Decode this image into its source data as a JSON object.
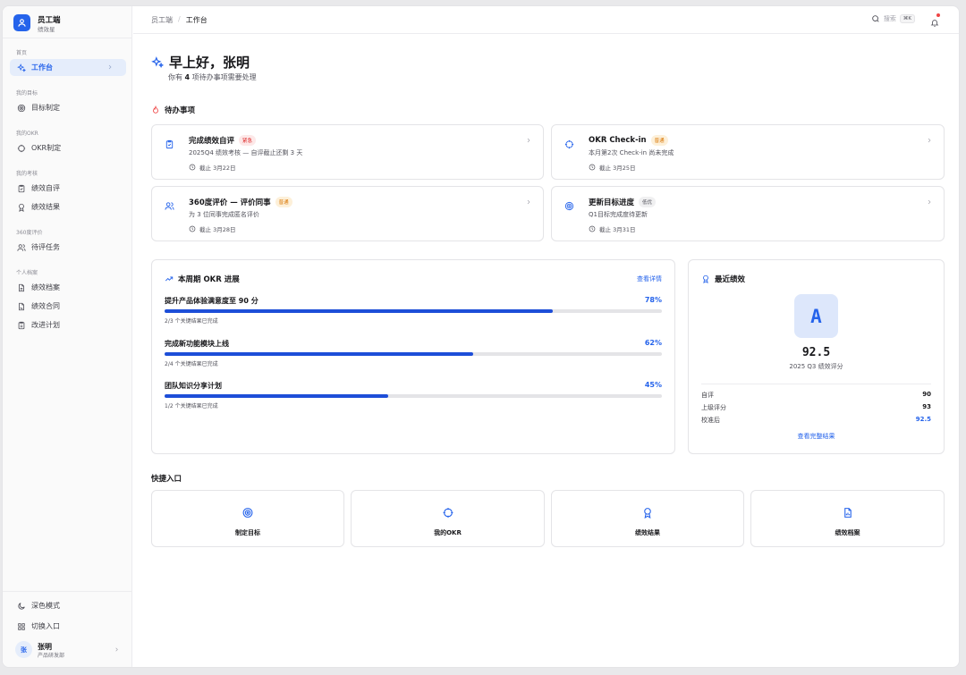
{
  "brand": {
    "title": "员工端",
    "subtitle": "绩效星"
  },
  "sidebar": {
    "sections": {
      "home": "首页",
      "goals": "我的目标",
      "okr": "我的OKR",
      "review": "我的考核",
      "eval360": "360度评价",
      "profile": "个人档案"
    },
    "items": {
      "workbench": "工作台",
      "goal_setting": "目标制定",
      "okr_setting": "OKR制定",
      "self_review": "绩效自评",
      "results": "绩效结果",
      "pending_tasks": "待评任务",
      "archive": "绩效档案",
      "contract": "绩效合同",
      "improve": "改进计划"
    },
    "bottom": {
      "dark_mode": "深色模式",
      "switch_portal": "切换入口"
    },
    "user": {
      "avatar": "张",
      "name": "张明",
      "dept": "产品研发部"
    }
  },
  "topbar": {
    "crumb_root": "员工端",
    "crumb_sep": "/",
    "crumb_current": "工作台",
    "search_label": "搜索",
    "search_kbd": "⌘K"
  },
  "greeting": {
    "title": "早上好，张明",
    "sub_prefix": "你有",
    "sub_count": "4",
    "sub_suffix": "项待办事项需要处理"
  },
  "todos": {
    "heading": "待办事项",
    "items": [
      {
        "title": "完成绩效自评",
        "badge": "紧急",
        "desc": "2025Q4 绩效考核 — 自评截止还剩 3 天",
        "due": "截止 3月22日"
      },
      {
        "title": "OKR Check-in",
        "badge": "普通",
        "desc": "本月第2次 Check-in 尚未完成",
        "due": "截止 3月25日"
      },
      {
        "title": "360度评价 — 评价同事",
        "badge": "普通",
        "desc": "为 3 位同事完成匿名评价",
        "due": "截止 3月28日"
      },
      {
        "title": "更新目标进度",
        "badge": "低优",
        "desc": "Q1目标完成度待更新",
        "due": "截止 3月31日"
      }
    ]
  },
  "okr": {
    "heading": "本周期 OKR 进展",
    "link": "查看详情",
    "items": [
      {
        "name": "提升产品体验满意度至 90 分",
        "percent_label": "78%",
        "progress": 78,
        "sub": "2/3 个关键结果已完成"
      },
      {
        "name": "完成新功能模块上线",
        "percent_label": "62%",
        "progress": 62,
        "sub": "2/4 个关键结果已完成"
      },
      {
        "name": "团队知识分享计划",
        "percent_label": "45%",
        "progress": 45,
        "sub": "1/2 个关键结果已完成"
      }
    ]
  },
  "performance": {
    "heading": "最近绩效",
    "grade": "A",
    "score": "92.5",
    "score_label": "2025 Q3 绩效评分",
    "rows": [
      {
        "label": "自评",
        "value": "90"
      },
      {
        "label": "上级评分",
        "value": "93"
      },
      {
        "label": "校准后",
        "value": "92.5"
      }
    ],
    "link": "查看完整结果"
  },
  "quick": {
    "heading": "快捷入口",
    "items": [
      {
        "label": "制定目标",
        "icon": "target-icon"
      },
      {
        "label": "我的OKR",
        "icon": "crosshair-icon"
      },
      {
        "label": "绩效结果",
        "icon": "award-icon"
      },
      {
        "label": "绩效档案",
        "icon": "file-chart-icon"
      }
    ]
  },
  "colors": {
    "accent": "#2563eb",
    "urgent": "#dc2626",
    "normal": "#d97706"
  }
}
